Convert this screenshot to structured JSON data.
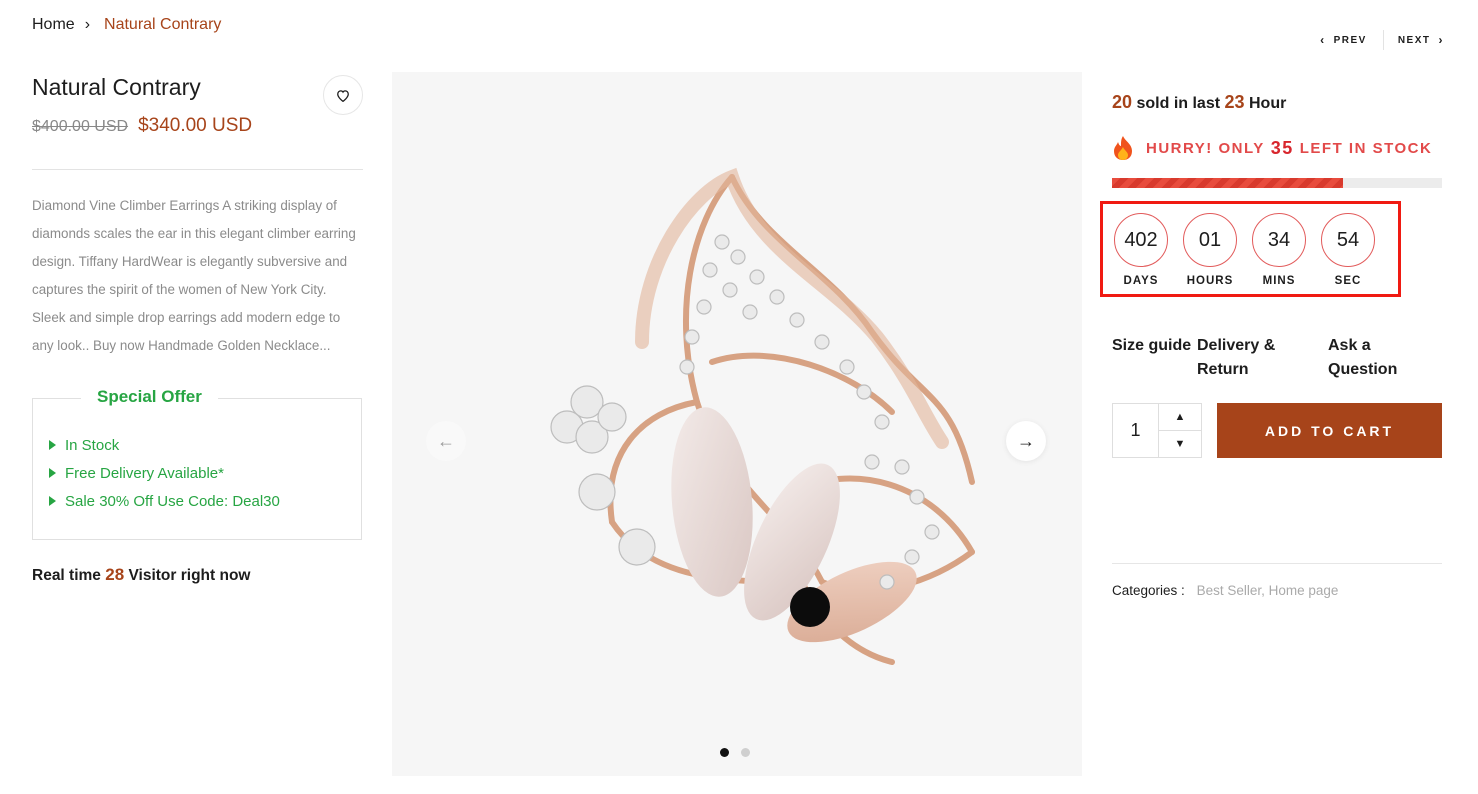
{
  "breadcrumb": {
    "home": "Home",
    "current": "Natural Contrary"
  },
  "pager": {
    "prev": "PREV",
    "next": "NEXT"
  },
  "product": {
    "title": "Natural Contrary",
    "old_price": "$400.00 USD",
    "price": "$340.00 USD",
    "description": "Diamond Vine Climber Earrings A striking display of diamonds scales the ear in this elegant climber earring design. Tiffany HardWear is elegantly subversive and captures the spirit of the women of New York City. Sleek and simple drop earrings add modern edge to any look.. Buy now Handmade Golden Necklace..."
  },
  "special_offer": {
    "title": "Special Offer",
    "items": [
      "In Stock",
      "Free Delivery Available*",
      "Sale 30% Off Use Code: Deal30"
    ]
  },
  "visitors": {
    "prefix": "Real time",
    "count": "28",
    "suffix": "Visitor right now"
  },
  "gallery": {
    "slide_count": 2,
    "active_slide": 1
  },
  "sales": {
    "sold": "20",
    "sold_text": "sold in last",
    "hours": "23",
    "hour_text": "Hour"
  },
  "stock": {
    "prefix": "HURRY! ONLY",
    "count": "35",
    "suffix": "LEFT IN STOCK",
    "progress_fraction": 0.7
  },
  "countdown": [
    {
      "value": "402",
      "label": "DAYS"
    },
    {
      "value": "01",
      "label": "HOURS"
    },
    {
      "value": "34",
      "label": "MINS"
    },
    {
      "value": "54",
      "label": "SEC"
    }
  ],
  "links": {
    "size_guide": "Size guide",
    "delivery": "Delivery & Return",
    "ask": "Ask a Question"
  },
  "cart": {
    "quantity": "1",
    "add_label": "ADD TO CART"
  },
  "categories": {
    "label": "Categories :",
    "items": [
      "Best Seller,",
      "Home page"
    ]
  },
  "colors": {
    "accent": "#a7441a",
    "offer_green": "#27a543",
    "stock_red": "#e24a4a",
    "highlight_box": "#f01a12"
  },
  "icons": {
    "wishlist": "heart-icon",
    "prev_slide": "arrow-left-icon",
    "next_slide": "arrow-right-icon",
    "fire": "fire-icon",
    "qty_up": "caret-up-icon",
    "qty_down": "caret-down-icon"
  }
}
